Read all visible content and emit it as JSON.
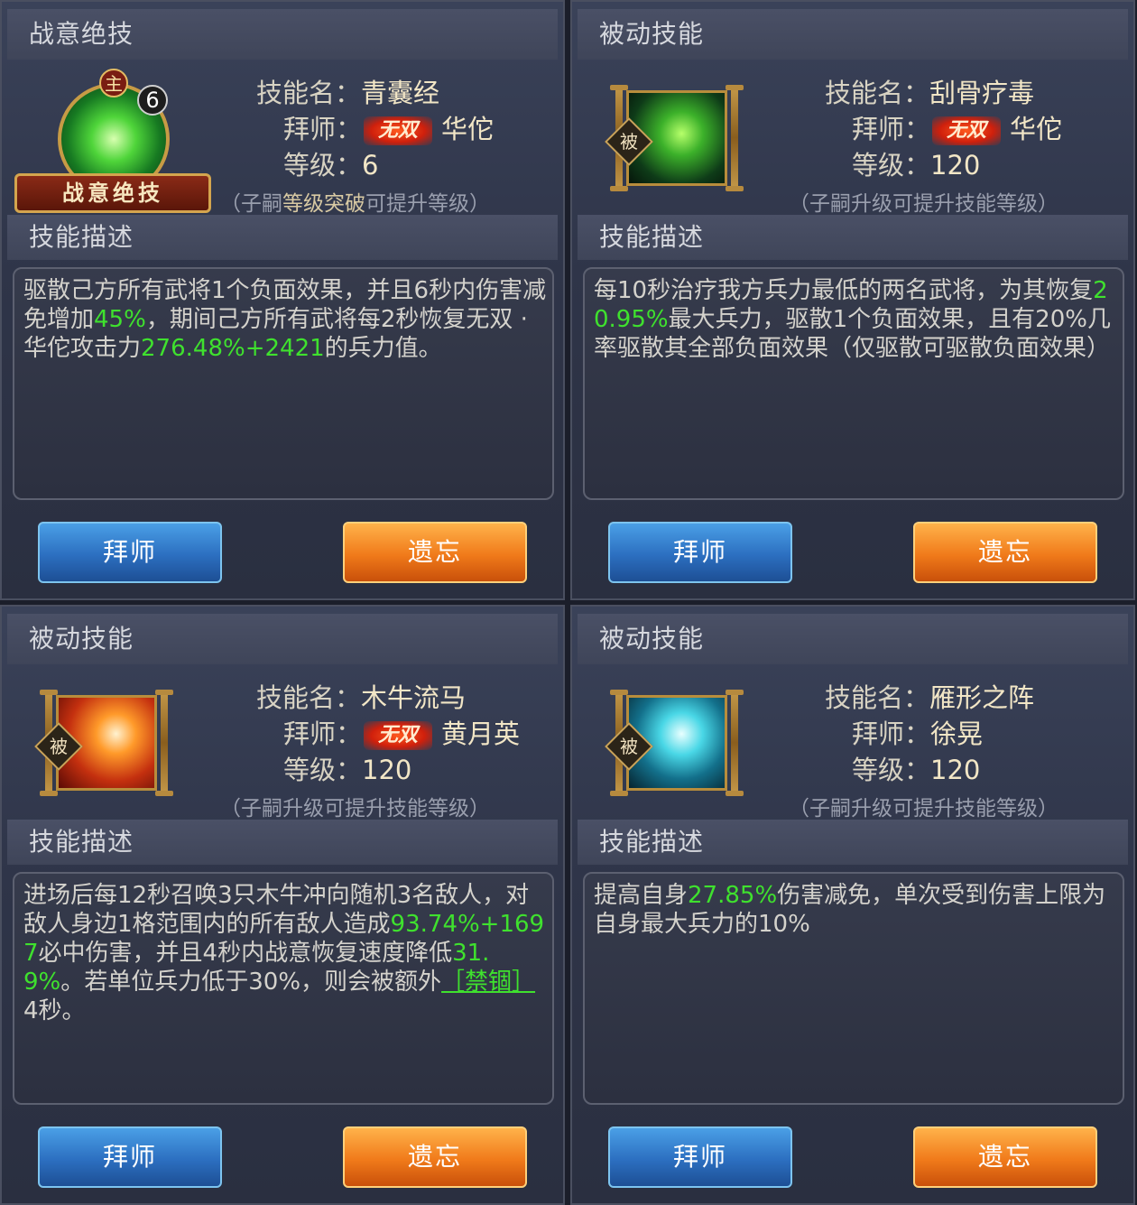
{
  "panels": [
    {
      "header": "战意绝技",
      "emblem": {
        "main_badge": "主",
        "level_badge": "6",
        "banner": "战意绝技",
        "icon": "green-leaf-orb-icon"
      },
      "name_label": "技能名：",
      "name": "青囊经",
      "master_label": "拜师：",
      "master_badge": "无双",
      "master": "华佗",
      "level_label": "等级：",
      "level": "6",
      "note_open": "（子嗣",
      "note_highlight": "等级突破",
      "note_close": "可提升等级）",
      "desc_header": "技能描述",
      "desc": [
        {
          "t": "驱散己方所有武将1个负面效果，并且6秒内伤害减免增加",
          "g": false
        },
        {
          "t": "45%",
          "g": true
        },
        {
          "t": "，期间己方所有武将每2秒恢复无双 · 华佗攻击力",
          "g": false
        },
        {
          "t": "276.48%+2421",
          "g": true
        },
        {
          "t": "的兵力值。",
          "g": false
        }
      ],
      "btn_learn": "拜师",
      "btn_forget": "遗忘"
    },
    {
      "header": "被动技能",
      "icon": "green-scroll-icon",
      "passive_badge": "被",
      "name_label": "技能名：",
      "name": "刮骨疗毒",
      "master_label": "拜师：",
      "master_badge": "无双",
      "master": "华佗",
      "level_label": "等级：",
      "level": "120",
      "note": "（子嗣升级可提升技能等级）",
      "desc_header": "技能描述",
      "desc": [
        {
          "t": "每10秒治疗我方兵力最低的两名武将，为其恢复",
          "g": false
        },
        {
          "t": "20.95%",
          "g": true
        },
        {
          "t": "最大兵力，驱散1个负面效果，且有20%几率驱散其全部负面效果（仅驱散可驱散负面效果）",
          "g": false
        }
      ],
      "btn_learn": "拜师",
      "btn_forget": "遗忘"
    },
    {
      "header": "被动技能",
      "icon": "fire-fist-icon",
      "passive_badge": "被",
      "name_label": "技能名：",
      "name": "木牛流马",
      "master_label": "拜师：",
      "master_badge": "无双",
      "master": "黄月英",
      "level_label": "等级：",
      "level": "120",
      "note": "（子嗣升级可提升技能等级）",
      "desc_header": "技能描述",
      "desc": [
        {
          "t": "进场后每12秒召唤3只木牛冲向随机3名敌人，对敌人身边1格范围内的所有敌人造成",
          "g": false
        },
        {
          "t": "93.74%+1697",
          "g": true
        },
        {
          "t": "必中伤害，并且4秒内战意恢复速度降低",
          "g": false
        },
        {
          "t": "31.9%",
          "g": true
        },
        {
          "t": "。若单位兵力低于30%，则会被额外",
          "g": false
        },
        {
          "t": "［禁锢］",
          "g": true,
          "link": true
        },
        {
          "t": "4秒。",
          "g": false
        }
      ],
      "btn_learn": "拜师",
      "btn_forget": "遗忘"
    },
    {
      "header": "被动技能",
      "icon": "ice-formation-icon",
      "passive_badge": "被",
      "name_label": "技能名：",
      "name": "雁形之阵",
      "master_label": "拜师：",
      "master": "徐晃",
      "level_label": "等级：",
      "level": "120",
      "note": "（子嗣升级可提升技能等级）",
      "desc_header": "技能描述",
      "desc": [
        {
          "t": "提高自身",
          "g": false
        },
        {
          "t": "27.85%",
          "g": true
        },
        {
          "t": "伤害减免，单次受到伤害上限为自身最大兵力的10%",
          "g": false
        }
      ],
      "btn_learn": "拜师",
      "btn_forget": "遗忘"
    }
  ]
}
